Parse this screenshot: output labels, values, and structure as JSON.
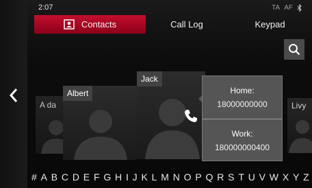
{
  "status": {
    "time": "2:07",
    "ta": "TA",
    "af": "AF",
    "bluetooth_icon": "bluetooth-icon"
  },
  "tabs": [
    {
      "label": "Contacts",
      "active": true,
      "icon": "contacts-card-icon"
    },
    {
      "label": "Call Log",
      "active": false
    },
    {
      "label": "Keypad",
      "active": false
    }
  ],
  "contacts": [
    {
      "name": "A da"
    },
    {
      "name": "Albert"
    },
    {
      "name": "Jack"
    },
    {
      "name": "Livy"
    }
  ],
  "popup": {
    "home_label": "Home:",
    "home_number": "18000000000",
    "work_label": "Work:",
    "work_number": "180000000400"
  },
  "alphabet": [
    "#",
    "A",
    "B",
    "C",
    "D",
    "E",
    "F",
    "G",
    "H",
    "I",
    "J",
    "K",
    "L",
    "M",
    "N",
    "O",
    "P",
    "Q",
    "R",
    "S",
    "T",
    "U",
    "V",
    "W",
    "X",
    "Y",
    "Z"
  ],
  "colors": {
    "accent": "#b3102b",
    "popup": "#555555",
    "search_bg": "#4a4a4a"
  }
}
